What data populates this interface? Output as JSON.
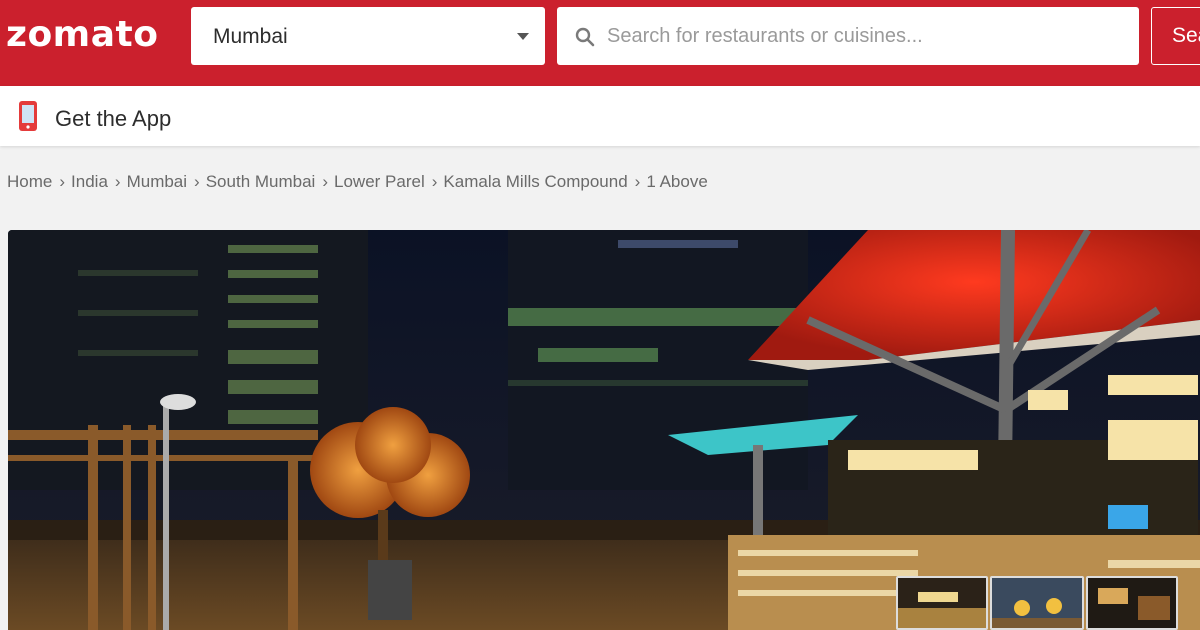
{
  "header": {
    "logo": "zomato",
    "city": "Mumbai",
    "search_placeholder": "Search for restaurants or cuisines...",
    "search_button": "Search"
  },
  "appbar": {
    "label": "Get the App"
  },
  "breadcrumb": [
    "Home",
    "India",
    "Mumbai",
    "South Mumbai",
    "Lower Parel",
    "Kamala Mills Compound",
    "1 Above"
  ],
  "colors": {
    "brand": "#cb202d"
  }
}
